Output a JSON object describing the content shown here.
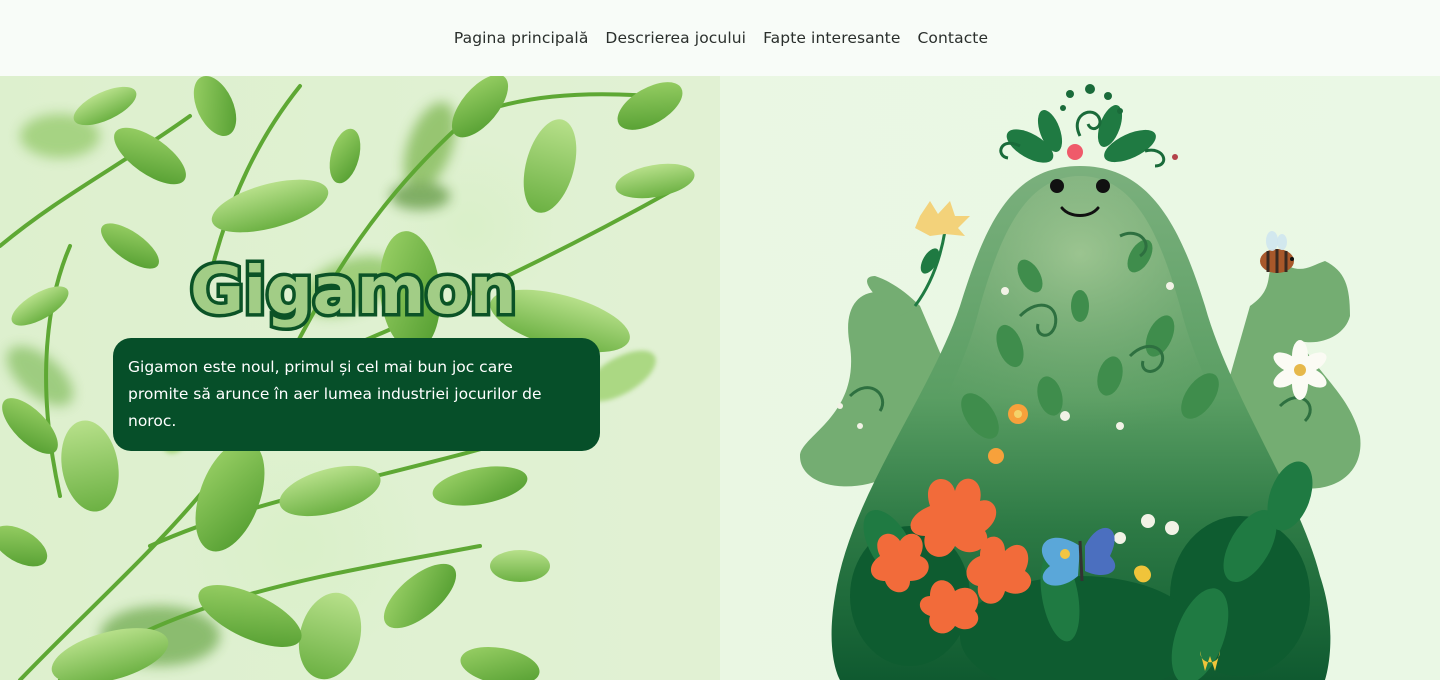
{
  "header": {
    "nav": [
      {
        "label": "Pagina principală"
      },
      {
        "label": "Descrierea jocului"
      },
      {
        "label": "Fapte interesante"
      },
      {
        "label": "Contacte"
      }
    ]
  },
  "hero": {
    "title": "Gigamon",
    "description": "Gigamon este noul, primul și cel mai bun joc care promite să arunce în aer lumea industriei jocurilor de noroc."
  },
  "colors": {
    "dark_green": "#064f29",
    "title_fill": "#a2cd86",
    "background": "#e3f3d7",
    "leaf_green": "#6fb33f",
    "flower_orange": "#f26b3a"
  },
  "icons": [
    "leaf-branch-illustration",
    "forest-mascot-illustration",
    "bee-icon",
    "butterfly-icon",
    "flower-icon"
  ]
}
